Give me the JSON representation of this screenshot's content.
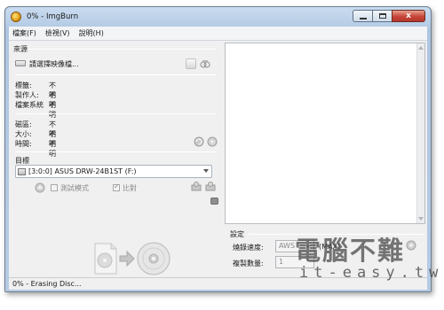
{
  "window": {
    "title": "0% - ImgBurn",
    "close_glyph": "x"
  },
  "menu": [
    {
      "label": "檔案(F)"
    },
    {
      "label": "檢視(V)"
    },
    {
      "label": "說明(H)"
    }
  ],
  "source": {
    "label": "來源",
    "placeholder": "請選擇映像檔..."
  },
  "info": [
    {
      "key": "標籤:",
      "value": "不明"
    },
    {
      "key": "製作人:",
      "value": "不明"
    },
    {
      "key": "檔案系統",
      "value": "不明"
    }
  ],
  "info2": [
    {
      "key": "磁區:",
      "value": "不明"
    },
    {
      "key": "大小:",
      "value": "不明"
    },
    {
      "key": "時間:",
      "value": "不明"
    }
  ],
  "target": {
    "label": "目標",
    "drive": "[3:0:0] ASUS DRW-24B1ST (F:)",
    "test_mode_label": "測試模式",
    "verify_label": "比對"
  },
  "settings": {
    "label": "設定",
    "speed_label": "燒錄速度:",
    "speed_value": "AWS",
    "speed_suffix": "(MAX)",
    "copies_label": "複製數量:",
    "copies_value": "1"
  },
  "status": {
    "text": "0% - Erasing Disc..."
  },
  "watermark": {
    "line1": "電腦不難",
    "line2": "it-easy.tw"
  },
  "colors": {
    "title_bar": "#b7cde6",
    "close_button": "#c6463a"
  }
}
